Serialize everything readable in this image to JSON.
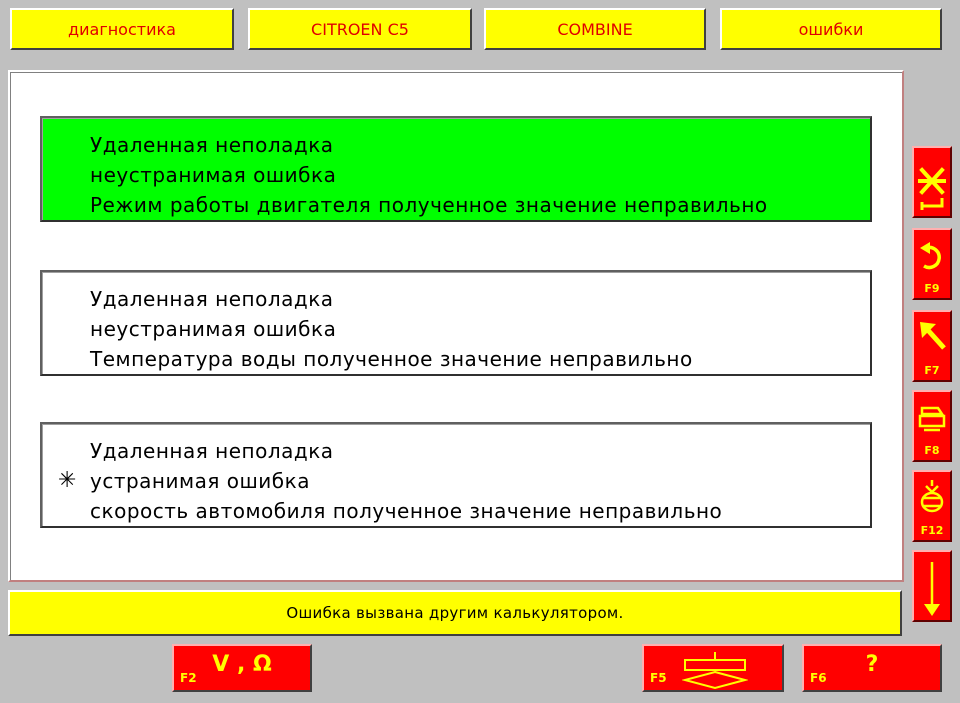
{
  "header": {
    "tabs": [
      {
        "label": "диагностика"
      },
      {
        "label": "CITROEN C5"
      },
      {
        "label": "COMBINE"
      },
      {
        "label": "ошибки"
      }
    ]
  },
  "faults": [
    {
      "lines": [
        "Удаленная неполадка",
        "неустранимая ошибка",
        "Режим работы двигателя полученное значение неправильно"
      ],
      "marker": "",
      "selected": true
    },
    {
      "lines": [
        "Удаленная неполадка",
        "неустранимая ошибка",
        "Температура воды полученное значение неправильно"
      ],
      "marker": "",
      "selected": false
    },
    {
      "lines": [
        "Удаленная неполадка",
        "устранимая ошибка",
        "скорость автомобиля полученное значение неправильно"
      ],
      "marker": "✳",
      "selected": false
    }
  ],
  "status": {
    "message": "Ошибка вызвана другим калькулятором."
  },
  "side_buttons": [
    {
      "icon": "cancel-icon",
      "fkey": ""
    },
    {
      "icon": "back-arrow-icon",
      "fkey": "F9"
    },
    {
      "icon": "up-left-arrow-icon",
      "fkey": "F7"
    },
    {
      "icon": "print-icon",
      "fkey": "F8"
    },
    {
      "icon": "memory-icon",
      "fkey": "F12"
    },
    {
      "icon": "scroll-down-icon",
      "fkey": ""
    }
  ],
  "bottom_buttons": [
    {
      "fkey": "F2",
      "label": "V , Ω",
      "icon": "measure-icon"
    },
    {
      "fkey": "F5",
      "label": "",
      "icon": "flowchart-icon"
    },
    {
      "fkey": "F6",
      "label": "?",
      "icon": "help-icon"
    }
  ],
  "colors": {
    "header_bg": "#ffff00",
    "header_text": "#e00000",
    "selected_row": "#00ff00",
    "button_bg": "#ff0000",
    "button_icon": "#ffff00"
  }
}
